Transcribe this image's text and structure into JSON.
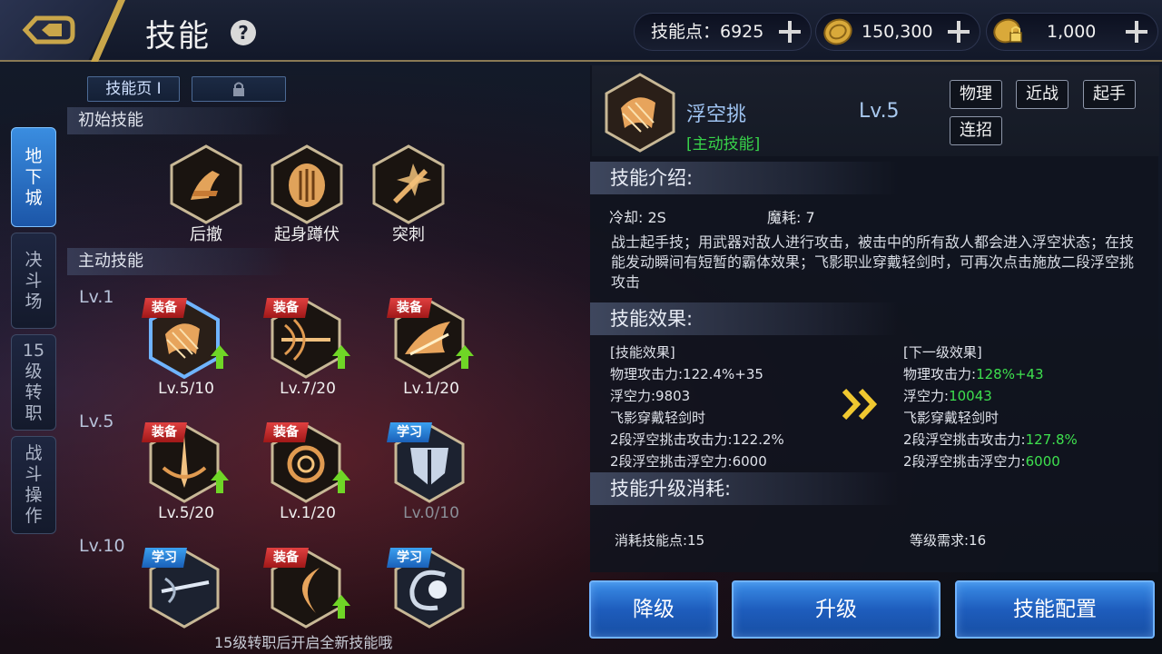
{
  "header": {
    "title": "技能",
    "help_icon": "question-icon",
    "skill_points_label": "技能点：6925",
    "gold": "150,300",
    "bound_gold": "1,000"
  },
  "sidebar": {
    "tabs": [
      {
        "label": [
          "地",
          "下",
          "城"
        ],
        "active": true
      },
      {
        "label": [
          "决",
          "斗",
          "场"
        ],
        "active": false
      },
      {
        "label": [
          "15",
          "级",
          "转",
          "职"
        ],
        "active": false
      },
      {
        "label": [
          "战",
          "斗",
          "操",
          "作"
        ],
        "active": false
      }
    ]
  },
  "page_tabs": {
    "page1": "技能页 Ⅰ",
    "page2_icon": "lock-icon"
  },
  "sections": {
    "initial": "初始技能",
    "active": "主动技能"
  },
  "initial_skills": [
    {
      "name": "后撤"
    },
    {
      "name": "起身蹲伏"
    },
    {
      "name": "突刺"
    }
  ],
  "level_labels": [
    "Lv.1",
    "Lv.5",
    "Lv.10"
  ],
  "active_skills": [
    {
      "badge": "装备",
      "level": "Lv.5/10",
      "upgradable": true
    },
    {
      "badge": "装备",
      "level": "Lv.7/20",
      "upgradable": true
    },
    {
      "badge": "装备",
      "level": "Lv.1/20",
      "upgradable": true
    },
    {
      "badge": "装备",
      "level": "Lv.5/20",
      "upgradable": true
    },
    {
      "badge": "装备",
      "level": "Lv.1/20",
      "upgradable": true
    },
    {
      "badge": "学习",
      "level": "Lv.0/10",
      "upgradable": false
    },
    {
      "badge": "学习",
      "level": "",
      "upgradable": false
    },
    {
      "badge": "装备",
      "level": "",
      "upgradable": true
    },
    {
      "badge": "学习",
      "level": "",
      "upgradable": false
    }
  ],
  "footnote": "15级转职后开启全新技能哦",
  "detail": {
    "name": "浮空挑",
    "type": "[主动技能]",
    "level": "Lv.5",
    "tags": [
      "物理",
      "近战",
      "起手",
      "连招"
    ],
    "intro_header": "技能介绍:",
    "cooldown": "冷却: 2S",
    "mana": "魔耗: 7",
    "description": "战士起手技；用武器对敌人进行攻击，被击中的所有敌人都会进入浮空状态；在技能发动瞬间有短暂的霸体效果；飞影职业穿戴轻剑时，可再次点击施放二段浮空挑攻击",
    "effect_header": "技能效果:",
    "current": {
      "title": "[技能效果]",
      "lines": [
        "物理攻击力:122.4%+35",
        "浮空力:9803",
        "飞影穿戴轻剑时",
        "2段浮空挑击攻击力:122.2%",
        "2段浮空挑击浮空力:6000"
      ]
    },
    "next": {
      "title": "[下一级效果]",
      "lines": [
        {
          "label": "物理攻击力:",
          "value": "128%+43"
        },
        {
          "label": "浮空力:",
          "value": "10043"
        },
        {
          "label": "飞影穿戴轻剑时",
          "value": ""
        },
        {
          "label": "2段浮空挑击攻击力:",
          "value": "127.8%"
        },
        {
          "label": "2段浮空挑击浮空力:",
          "value": "6000"
        }
      ]
    },
    "cost_header": "技能升级消耗:",
    "cost_points": "消耗技能点:15",
    "level_req": "等级需求:16"
  },
  "buttons": {
    "downgrade": "降级",
    "upgrade": "升级",
    "config": "技能配置"
  },
  "colors": {
    "accent_green": "#3ee04e",
    "button_blue": "#2a72d4",
    "equip_red": "#c02828",
    "learn_blue": "#2a80d8"
  }
}
